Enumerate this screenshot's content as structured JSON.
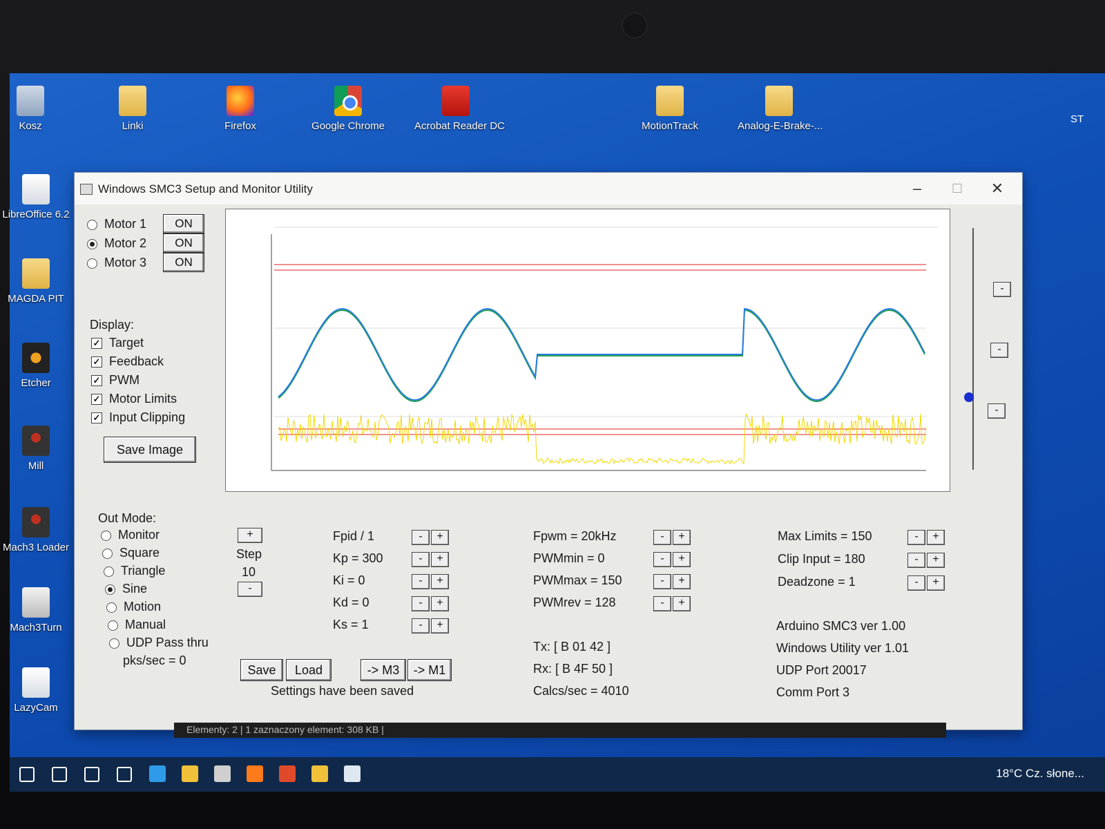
{
  "desktop": {
    "icons_top": [
      {
        "label": "Kosz",
        "icon": "recycle-bin-icon"
      },
      {
        "label": "Linki",
        "icon": "folder-icon"
      },
      {
        "label": "Firefox",
        "icon": "firefox-icon"
      },
      {
        "label": "Google Chrome",
        "icon": "chrome-icon"
      },
      {
        "label": "Acrobat Reader DC",
        "icon": "pdf-icon"
      },
      {
        "label": "MotionTrack",
        "icon": "folder-icon"
      },
      {
        "label": "Analog-E-Brake-...",
        "icon": "folder-icon"
      }
    ],
    "icons_left": [
      {
        "label": "LibreOffice 6.2",
        "icon": "document-icon"
      },
      {
        "label": "MAGDA PIT",
        "icon": "folder-icon"
      },
      {
        "label": "Etcher",
        "icon": "disc-icon"
      },
      {
        "label": "Mill",
        "icon": "mach-icon"
      },
      {
        "label": "Mach3 Loader",
        "icon": "mach-icon"
      },
      {
        "label": "Mach3Turn",
        "icon": "lathe-icon"
      },
      {
        "label": "LazyCam",
        "icon": "document-icon"
      }
    ],
    "edge_text": "ST"
  },
  "window": {
    "title": "Windows SMC3 Setup and Monitor Utility",
    "motors": [
      {
        "label": "Motor 1",
        "state": "ON",
        "selected": false
      },
      {
        "label": "Motor 2",
        "state": "ON",
        "selected": true
      },
      {
        "label": "Motor 3",
        "state": "ON",
        "selected": false
      }
    ],
    "display": {
      "header": "Display:",
      "items": [
        {
          "label": "Target",
          "checked": true
        },
        {
          "label": "Feedback",
          "checked": true
        },
        {
          "label": "PWM",
          "checked": true
        },
        {
          "label": "Motor Limits",
          "checked": true
        },
        {
          "label": "Input Clipping",
          "checked": true
        }
      ],
      "save_image": "Save Image"
    },
    "out_mode": {
      "header": "Out Mode:",
      "options": [
        {
          "label": "Monitor",
          "selected": false
        },
        {
          "label": "Square",
          "selected": false
        },
        {
          "label": "Triangle",
          "selected": false
        },
        {
          "label": "Sine",
          "selected": true
        },
        {
          "label": "Motion",
          "selected": false
        },
        {
          "label": "Manual",
          "selected": false
        },
        {
          "label": "UDP Pass thru",
          "selected": false
        }
      ],
      "pks": "pks/sec = 0"
    },
    "step": {
      "plus": "+",
      "label": "Step",
      "value": "10",
      "minus": "-"
    },
    "pid_params": [
      "Fpid / 1",
      "Kp = 300",
      "Ki = 0",
      "Kd = 0",
      "Ks = 1"
    ],
    "pwm_params": [
      "Fpwm = 20kHz",
      "PWMmin = 0",
      "PWMmax = 150",
      "PWMrev = 128"
    ],
    "limit_params": [
      "Max Limits = 150",
      "Clip Input = 180",
      "Deadzone = 1"
    ],
    "minus_glyph": "-",
    "plus_glyph": "+",
    "buttons": {
      "save": "Save",
      "load": "Load",
      "m3": "-> M3",
      "m1": "-> M1"
    },
    "status": "Settings have been saved",
    "comm": {
      "tx": "Tx: [ B 01 42 ]",
      "rx": "Rx: [ B 4F 50 ]",
      "calcs": "Calcs/sec = 4010"
    },
    "info": [
      "Arduino SMC3 ver 1.00",
      "Windows Utility ver 1.01",
      "UDP Port 20017",
      "Comm Port 3"
    ],
    "colors": {
      "target": "#2a7de0",
      "feedback": "#20a050",
      "pwm": "#f0d800",
      "limits": "#e02020"
    }
  },
  "explorer_status": "Elementy: 2   |   1 zaznaczony element: 308 KB   |",
  "taskbar": {
    "weather": "18°C  Cz. słone...",
    "icons": [
      "start-icon",
      "search-icon",
      "cortana-icon",
      "task-view-icon",
      "edge-icon",
      "file-explorer-icon",
      "store-icon",
      "firefox-icon",
      "chrome-icon",
      "folder-icon",
      "smc3-app-icon"
    ]
  }
}
